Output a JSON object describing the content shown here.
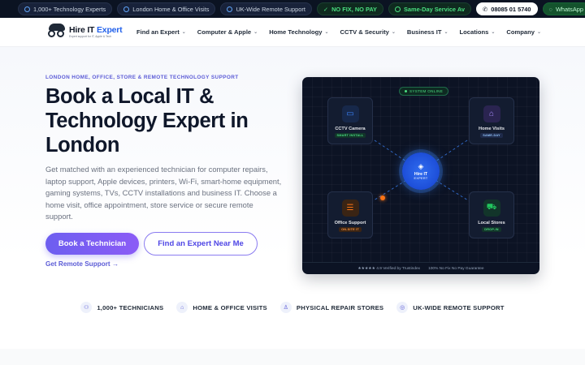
{
  "topbar": {
    "items": [
      {
        "label": "1,000+ Technology Experts",
        "icon": "users-icon"
      },
      {
        "label": "London Home & Office Visits",
        "icon": "location-pin-icon"
      },
      {
        "label": "UK-Wide Remote Support",
        "icon": "globe-icon"
      },
      {
        "label": "NO FIX, NO PAY",
        "icon": "check-icon"
      },
      {
        "label": "Same-Day Service Av",
        "icon": "clock-icon"
      }
    ],
    "phone": "08085 01 5740",
    "whatsapp": "WhatsApp"
  },
  "nav": {
    "logo_text_a": "Hire IT",
    "logo_text_b": "Expert",
    "logo_tagline": "Expert support for IT, Apple & Tech",
    "menu": [
      "Find an Expert",
      "Computer & Apple",
      "Home Technology",
      "CCTV & Security",
      "Business IT",
      "Locations",
      "Company"
    ]
  },
  "hero": {
    "eyebrow": "LONDON HOME, OFFICE, STORE & REMOTE TECHNOLOGY SUPPORT",
    "headline": "Book a Local IT & Technology Expert in London",
    "subcopy": "Get matched with an experienced technician for computer repairs, laptop support, Apple devices, printers, Wi-Fi, smart-home equipment, gaming systems, TVs, CCTV installations and business IT. Choose a home visit, office appointment, store service or secure remote support.",
    "primary_cta": "Book a Technician",
    "secondary_cta": "Find an Expert Near Me",
    "remote_link": "Get Remote Support →"
  },
  "panel": {
    "status": "SYSTEM ONLINE",
    "hub_name": "Hire IT",
    "hub_sub": "EXPERT",
    "nodes": [
      {
        "label": "CCTV Camera",
        "tag": "SMART INSTALL",
        "icon": "camera-icon",
        "color": "#3b82f6"
      },
      {
        "label": "Home Visits",
        "tag": "SAME-DAY",
        "icon": "home-icon",
        "color": "#a78bfa"
      },
      {
        "label": "Office Support",
        "tag": "ON-SITE IT",
        "icon": "server-icon",
        "color": "#f97316"
      },
      {
        "label": "Local Stores",
        "tag": "DROP-IN",
        "icon": "cart-icon",
        "color": "#22c55e"
      }
    ],
    "footer_left": "★★★★★ 4.9 Verified by Trustindex",
    "footer_right": "100% No Fix No Pay Guarantee"
  },
  "stats": [
    {
      "label": "1,000+ TECHNICIANS",
      "icon": "users-icon"
    },
    {
      "label": "HOME & OFFICE VISITS",
      "icon": "home-icon"
    },
    {
      "label": "PHYSICAL REPAIR STORES",
      "icon": "person-icon"
    },
    {
      "label": "UK-WIDE REMOTE SUPPORT",
      "icon": "globe-icon"
    }
  ]
}
